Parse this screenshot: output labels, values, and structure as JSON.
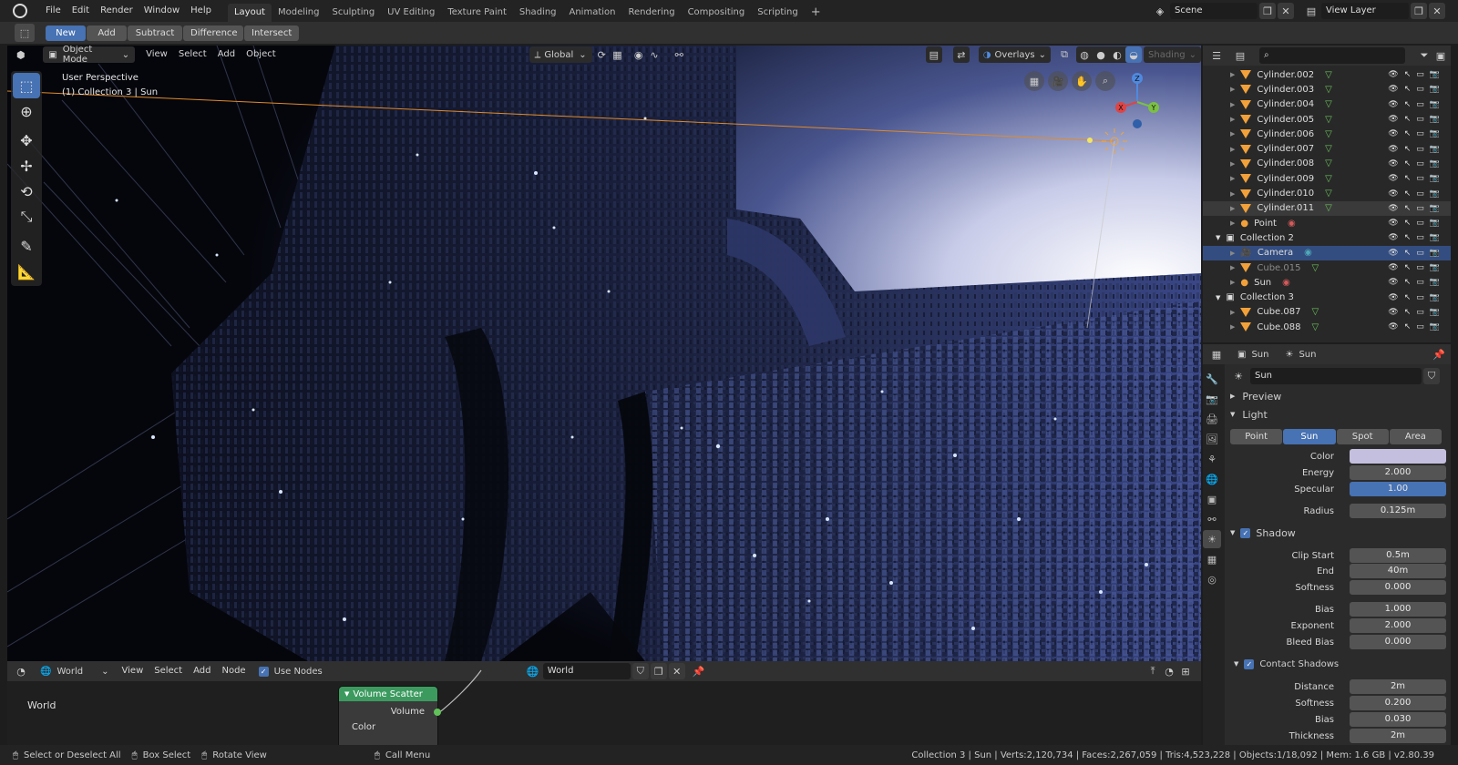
{
  "menu": {
    "items": [
      "File",
      "Edit",
      "Render",
      "Window",
      "Help"
    ]
  },
  "workspaces": {
    "tabs": [
      "Layout",
      "Modeling",
      "Sculpting",
      "UV Editing",
      "Texture Paint",
      "Shading",
      "Animation",
      "Rendering",
      "Compositing",
      "Scripting"
    ],
    "active": "Layout",
    "add_icon": "+"
  },
  "scene": {
    "name": "Scene",
    "view_layer": "View Layer"
  },
  "tool_header": {
    "buttons": [
      "New",
      "Add",
      "Subtract",
      "Difference",
      "Intersect"
    ],
    "active": "New"
  },
  "viewport": {
    "mode": "Object Mode",
    "menus": [
      "View",
      "Select",
      "Add",
      "Object"
    ],
    "orientation": "Global",
    "overlays_label": "Overlays",
    "shading_label": "Shading",
    "info_line1": "User Perspective",
    "info_line2": "(1) Collection 3 | Sun",
    "gizmo": {
      "x": "X",
      "y": "Y",
      "z": "Z"
    }
  },
  "outliner": {
    "rows": [
      {
        "label": "Cylinder.002",
        "kind": "mesh",
        "depth": 2
      },
      {
        "label": "Cylinder.003",
        "kind": "mesh",
        "depth": 2
      },
      {
        "label": "Cylinder.004",
        "kind": "mesh",
        "depth": 2
      },
      {
        "label": "Cylinder.005",
        "kind": "mesh",
        "depth": 2
      },
      {
        "label": "Cylinder.006",
        "kind": "mesh",
        "depth": 2
      },
      {
        "label": "Cylinder.007",
        "kind": "mesh",
        "depth": 2
      },
      {
        "label": "Cylinder.008",
        "kind": "mesh",
        "depth": 2
      },
      {
        "label": "Cylinder.009",
        "kind": "mesh",
        "depth": 2
      },
      {
        "label": "Cylinder.010",
        "kind": "mesh",
        "depth": 2
      },
      {
        "label": "Cylinder.011",
        "kind": "mesh",
        "depth": 2
      },
      {
        "label": "Point",
        "kind": "light",
        "depth": 2
      },
      {
        "label": "Collection 2",
        "kind": "collection",
        "depth": 1
      },
      {
        "label": "Camera",
        "kind": "camera",
        "depth": 2
      },
      {
        "label": "Cube.015",
        "kind": "mesh",
        "depth": 2
      },
      {
        "label": "Sun",
        "kind": "light",
        "depth": 2
      },
      {
        "label": "Collection 3",
        "kind": "collection",
        "depth": 1
      },
      {
        "label": "Cube.087",
        "kind": "mesh",
        "depth": 2
      },
      {
        "label": "Cube.088",
        "kind": "mesh",
        "depth": 2
      }
    ]
  },
  "properties": {
    "breadcrumb_object": "Sun",
    "breadcrumb_data": "Sun",
    "datablock_name": "Sun",
    "preview_label": "Preview",
    "light_label": "Light",
    "light_types": [
      "Point",
      "Sun",
      "Spot",
      "Area"
    ],
    "light_type_active": "Sun",
    "color_label": "Color",
    "color_value": "#c4bfde",
    "energy_label": "Energy",
    "energy": "2.000",
    "specular_label": "Specular",
    "specular": "1.00",
    "radius_label": "Radius",
    "radius": "0.125m",
    "shadow_label": "Shadow",
    "clip_start_label": "Clip Start",
    "clip_start": "0.5m",
    "end_label": "End",
    "end": "40m",
    "softness_label": "Softness",
    "softness": "0.000",
    "bias_label": "Bias",
    "bias": "1.000",
    "exponent_label": "Exponent",
    "exponent": "2.000",
    "bleed_bias_label": "Bleed Bias",
    "bleed_bias": "0.000",
    "contact_shadows_label": "Contact Shadows",
    "distance_label": "Distance",
    "distance": "2m",
    "c_softness_label": "Softness",
    "c_softness": "0.200",
    "c_bias_label": "Bias",
    "c_bias": "0.030",
    "thickness_label": "Thickness",
    "thickness": "2m"
  },
  "node_editor": {
    "type_label": "World",
    "menus": [
      "View",
      "Select",
      "Add",
      "Node"
    ],
    "use_nodes_label": "Use Nodes",
    "world_name": "World",
    "canvas_label": "World",
    "node_title": "Volume Scatter",
    "node_output": "Volume",
    "node_input": "Color"
  },
  "statusbar": {
    "hint1": "Select or Deselect All",
    "hint2": "Box Select",
    "hint3": "Rotate View",
    "hint4": "Call Menu",
    "stats": "Collection 3 | Sun | Verts:2,120,734 | Faces:2,267,059 | Tris:4,523,228 | Objects:1/18,092 | Mem: 1.6 GB | v2.80.39"
  },
  "colors": {
    "accent": "#4772b3",
    "header": "#303030",
    "panel": "#2b2b2b",
    "node_header": "#3c9a5f"
  }
}
